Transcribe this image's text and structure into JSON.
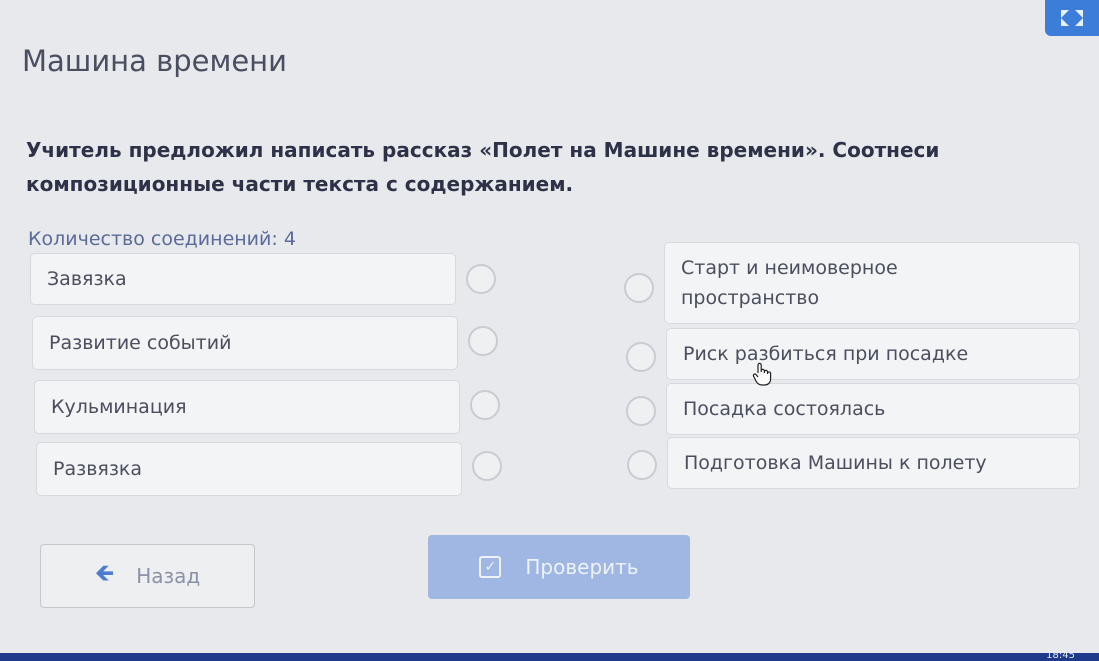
{
  "header": {
    "title": "Машина времени"
  },
  "task": {
    "text": "Учитель предложил написать рассказ «Полет на Машине времени». Соотнеси композиционные части текста с содержанием."
  },
  "count_label": "Количество соединений: 4",
  "left_items": [
    {
      "label": "Завязка"
    },
    {
      "label": "Развитие событий"
    },
    {
      "label": "Кульминация"
    },
    {
      "label": "Развязка"
    }
  ],
  "right_items": [
    {
      "label": "Старт и неимоверное пространство"
    },
    {
      "label": "Риск разбиться при посадке"
    },
    {
      "label": "Посадка состоялась"
    },
    {
      "label": "Подготовка Машины к полету"
    }
  ],
  "buttons": {
    "back_label": "Назад",
    "check_label": "Проверить"
  },
  "taskbar": {
    "clock": "18:45"
  },
  "colors": {
    "accent": "#3b7dd8",
    "check_button": "#9fb7e2",
    "back_arrow": "#4f7bd0"
  },
  "icons": [
    "fullscreen-icon",
    "arrow-left-icon",
    "checkbox-icon",
    "hand-cursor-icon"
  ]
}
